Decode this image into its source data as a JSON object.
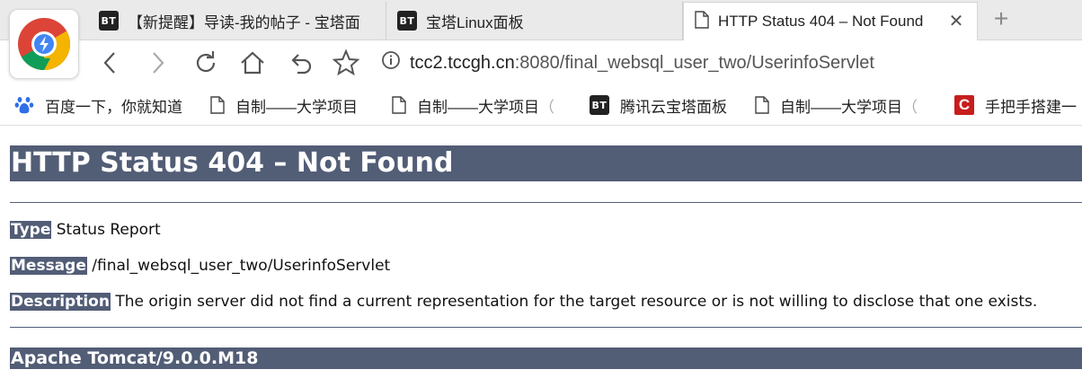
{
  "browser": {
    "tabs": [
      {
        "icon": "bt-icon",
        "icon_text": "BT",
        "title": "【新提醒】导读-我的帖子 - 宝塔面",
        "active": false
      },
      {
        "icon": "bt-icon",
        "icon_text": "BT",
        "title": "宝塔Linux面板",
        "active": false
      },
      {
        "icon": "page-icon",
        "icon_text": "",
        "title": "HTTP Status 404 – Not Found",
        "active": true
      }
    ],
    "close_tab_glyph": "✕",
    "new_tab_glyph": "+",
    "address": {
      "host": "tcc2.tccgh.cn",
      "rest": ":8080/final_websql_user_two/UserinfoServlet"
    },
    "bookmarks": [
      {
        "icon": "baidu-paw-icon",
        "label": "百度一下，你就知道",
        "fade": ""
      },
      {
        "icon": "page-icon",
        "label": "自制——大学项目",
        "fade": ""
      },
      {
        "icon": "page-icon",
        "label": "自制——大学项目",
        "fade": "（"
      },
      {
        "icon": "bt-icon",
        "icon_text": "BT",
        "label": "腾讯云宝塔面板",
        "fade": ""
      },
      {
        "icon": "page-icon",
        "label": "自制——大学项目",
        "fade": "（"
      },
      {
        "icon": "csdn-icon",
        "icon_text": "C",
        "label": "手把手搭建一",
        "fade": ""
      }
    ],
    "colors": {
      "tabbar": "#eaeaea",
      "accent_logo_red": "#db4437",
      "accent_logo_yellow": "#f4b400",
      "accent_logo_green": "#0f9d58",
      "accent_logo_blue": "#4285f4"
    }
  },
  "page": {
    "heading": "HTTP Status 404 – Not Found",
    "type_label": "Type",
    "type_value": "Status Report",
    "message_label": "Message",
    "message_value": "/final_websql_user_two/UserinfoServlet",
    "description_label": "Description",
    "description_value": "The origin server did not find a current representation for the target resource or is not willing to disclose that one exists.",
    "footer": "Apache Tomcat/9.0.0.M18",
    "colors": {
      "header_bg": "#525d76",
      "header_fg": "#ffffff"
    }
  }
}
